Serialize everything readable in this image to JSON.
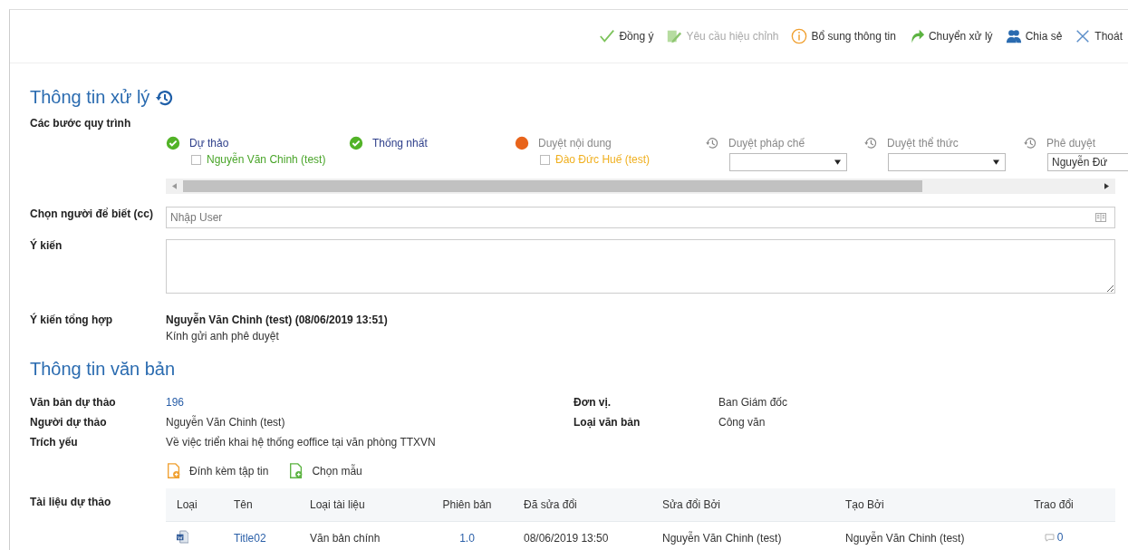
{
  "toolbar": [
    {
      "label": "Đồng ý",
      "kind": "approve",
      "disabled": false
    },
    {
      "label": "Yêu cầu hiệu chỉnh",
      "kind": "edit",
      "disabled": true
    },
    {
      "label": "Bổ sung thông tin",
      "kind": "info",
      "disabled": false
    },
    {
      "label": "Chuyển xử lý",
      "kind": "forward",
      "disabled": false
    },
    {
      "label": "Chia sẻ",
      "kind": "share",
      "disabled": false
    },
    {
      "label": "Thoát",
      "kind": "close",
      "disabled": false
    }
  ],
  "processing": {
    "title": "Thông tin xử lý",
    "steps_label": "Các bước quy trình",
    "steps": [
      {
        "kind": "done",
        "name": "Dự thảo",
        "person": "Nguyễn Văn Chinh (test)"
      },
      {
        "kind": "done",
        "name": "Thống nhất"
      },
      {
        "kind": "current",
        "name": "Duyệt nội dung",
        "person": "Đào Đức Huế (test)"
      },
      {
        "kind": "pending",
        "name": "Duyệt pháp chế"
      },
      {
        "kind": "pending",
        "name": "Duyệt thể thức"
      },
      {
        "kind": "pending",
        "name": "Phê duyệt",
        "value": "Nguyễn Đứ"
      }
    ],
    "cc_label": "Chọn người để biết (cc)",
    "cc_placeholder": "Nhập User",
    "opinion_label": "Ý kiến",
    "summary_label": "Ý kiến tổng hợp",
    "summary_author": "Nguyễn Văn Chinh (test) (08/06/2019 13:51)",
    "summary_text": "Kính gửi anh phê duyệt"
  },
  "document": {
    "title": "Thông tin văn bản",
    "fields_left": [
      {
        "label": "Văn bản dự thảo",
        "value": "196",
        "link": true
      },
      {
        "label": "Người dự thảo",
        "value": "Nguyễn Văn Chinh (test)",
        "link": false
      },
      {
        "label": "Trích yếu",
        "value": "Về việc triển khai hệ thống eoffice tại văn phòng TTXVN",
        "link": false
      }
    ],
    "fields_right": [
      {
        "label": "Đơn vị.",
        "value": "Ban Giám đốc"
      },
      {
        "label": "Loại văn bản",
        "value": "Công văn"
      }
    ],
    "actions": [
      {
        "label": "Đính kèm tập tin",
        "kind": "attach"
      },
      {
        "label": "Chọn mẫu",
        "kind": "template"
      }
    ],
    "files_label": "Tài liệu dự thảo",
    "table": {
      "columns": [
        "Loại",
        "Tên",
        "Loại tài liệu",
        "Phiên bản",
        "Đã sửa đổi",
        "Sửa đổi Bởi",
        "Tạo Bởi",
        "Trao đổi"
      ],
      "rows": [
        {
          "name": "Title02",
          "type": "Văn bản chính",
          "version": "1.0",
          "modified": "08/06/2019 13:50",
          "modified_by": "Nguyễn Văn Chinh (test)",
          "created_by": "Nguyễn Văn Chinh (test)",
          "comments": "0"
        }
      ]
    }
  }
}
